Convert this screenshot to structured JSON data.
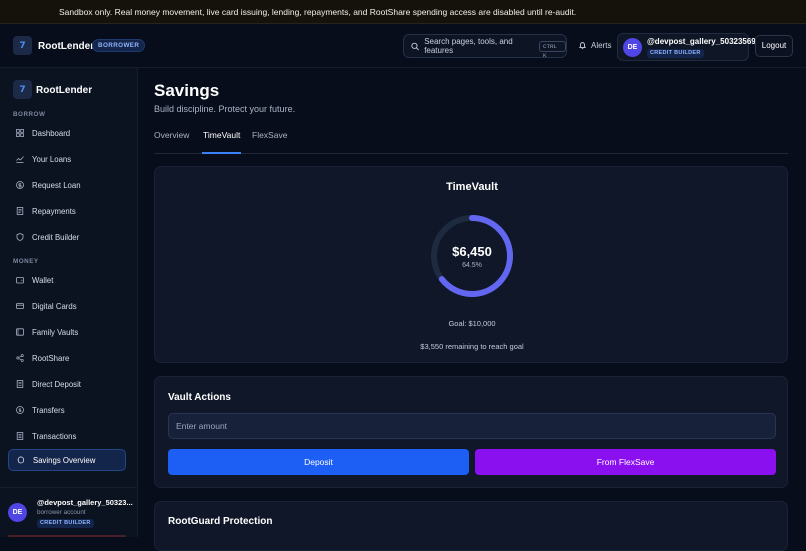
{
  "banner": {
    "text": "Sandbox only. Real money movement, live card issuing, lending, repayments, and RootShare spending access are disabled until re-audit."
  },
  "topbar": {
    "brand": "RootLender",
    "role": "BORROWER",
    "search_label": "Search pages, tools, and features",
    "search_shortcut": "CTRL K",
    "alerts_label": "Alerts",
    "user_initials": "DE",
    "username": "@devpost_gallery_50323569",
    "user_badge": "CREDIT BUILDER",
    "logout_label": "Logout"
  },
  "sidebar": {
    "brand": "RootLender",
    "sections": [
      {
        "label": "BORROW",
        "items": [
          {
            "label": "Dashboard",
            "icon": "grid-icon"
          },
          {
            "label": "Your Loans",
            "icon": "loans-icon"
          },
          {
            "label": "Request Loan",
            "icon": "dollar-circle-icon"
          },
          {
            "label": "Repayments",
            "icon": "receipt-icon"
          },
          {
            "label": "Credit Builder",
            "icon": "shield-icon"
          }
        ]
      },
      {
        "label": "MONEY",
        "items": [
          {
            "label": "Wallet",
            "icon": "wallet-icon"
          },
          {
            "label": "Digital Cards",
            "icon": "card-icon"
          },
          {
            "label": "Family Vaults",
            "icon": "vault-icon"
          },
          {
            "label": "RootShare",
            "icon": "share-icon"
          },
          {
            "label": "Direct Deposit",
            "icon": "document-icon"
          },
          {
            "label": "Transfers",
            "icon": "transfer-icon"
          },
          {
            "label": "Transactions",
            "icon": "list-icon"
          },
          {
            "label": "Savings Overview",
            "icon": "piggy-icon",
            "active": true
          }
        ]
      }
    ],
    "user": {
      "initials": "DE",
      "name": "@devpost_gallery_50323...",
      "subtitle": "borrower account",
      "badge": "CREDIT BUILDER"
    }
  },
  "main": {
    "title": "Savings",
    "subtitle": "Build discipline. Protect your future.",
    "tabs": [
      {
        "label": "Overview",
        "active": false
      },
      {
        "label": "TimeVault",
        "active": true
      },
      {
        "label": "FlexSave",
        "active": false
      }
    ],
    "timevault": {
      "title": "TimeVault",
      "amount": "$6,450",
      "percent_label": "64.5%",
      "progress": 0.645,
      "goal": "Goal: $10,000",
      "remaining": "$3,550 remaining to reach goal"
    },
    "vault_actions": {
      "title": "Vault Actions",
      "amount_placeholder": "Enter amount",
      "deposit_label": "Deposit",
      "flexsave_label": "From FlexSave"
    },
    "rootguard": {
      "title": "RootGuard Protection"
    }
  },
  "colors": {
    "accent": "#3b82f6",
    "progress_ring": "#6366f1",
    "deposit_button": "#1d5ef5",
    "flexsave_button": "#8b10f0"
  }
}
